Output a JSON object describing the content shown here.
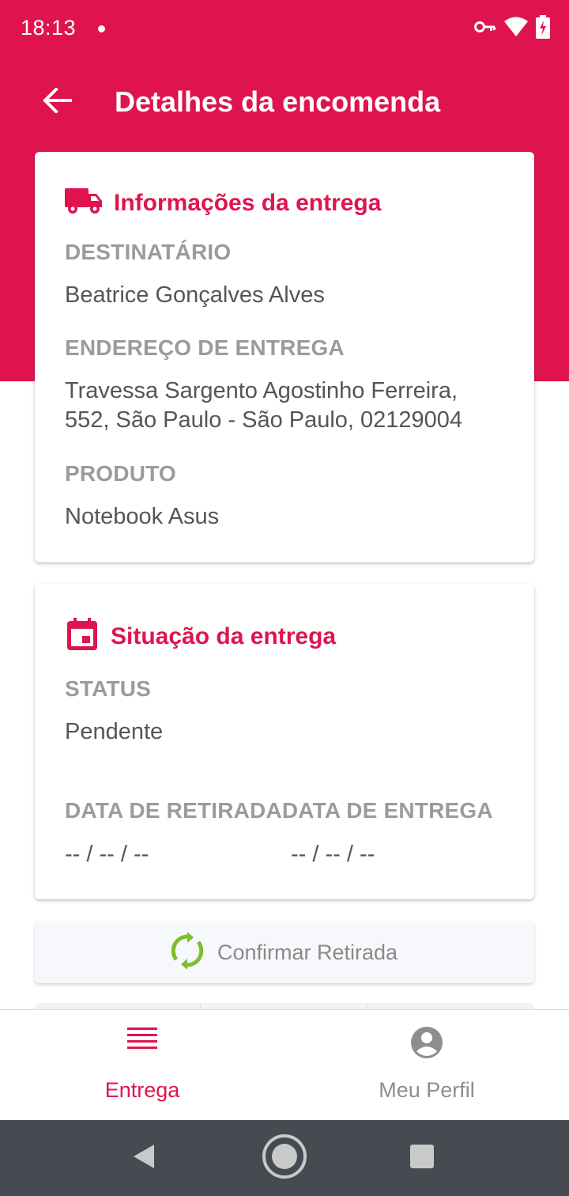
{
  "status_bar": {
    "time": "18:13",
    "icons": [
      "vpn-key-icon",
      "wifi-icon",
      "battery-charging-icon"
    ]
  },
  "app_bar": {
    "title": "Detalhes da encomenda",
    "back_icon": "arrow-left-icon"
  },
  "delivery_info": {
    "title": "Informações da entrega",
    "icon": "truck-icon",
    "recipient_label": "DESTINATÁRIO",
    "recipient_value": "Beatrice Gonçalves Alves",
    "address_label": "ENDEREÇO DE ENTREGA",
    "address_line1": "Travessa Sargento Agostinho Ferreira,",
    "address_line2": "552, São Paulo - São Paulo, 02129004",
    "product_label": "PRODUTO",
    "product_value": "Notebook Asus"
  },
  "delivery_status": {
    "title": "Situação da entrega",
    "icon": "calendar-icon",
    "status_label": "STATUS",
    "status_value": "Pendente",
    "pickup_date_label": "DATA DE RETIRADA",
    "delivery_date_label": "DATA DE ENTREGA",
    "pickup_date_value": "-- / -- / --",
    "delivery_date_value": "-- / -- / --"
  },
  "confirm_button": {
    "label": "Confirmar Retirada",
    "icon": "sync-icon"
  },
  "bottom_nav": {
    "items": [
      {
        "label": "Entrega",
        "icon": "list-icon",
        "active": true
      },
      {
        "label": "Meu Perfil",
        "icon": "account-circle-icon",
        "active": false
      }
    ]
  },
  "system_nav": [
    "back-triangle-icon",
    "home-circle-icon",
    "recents-square-icon"
  ],
  "colors": {
    "primary": "#DF144F",
    "label_gray": "#9b9b9b",
    "value_gray": "#555555",
    "sync_green": "#7DBE2E",
    "system_nav_bg": "#454B50"
  }
}
